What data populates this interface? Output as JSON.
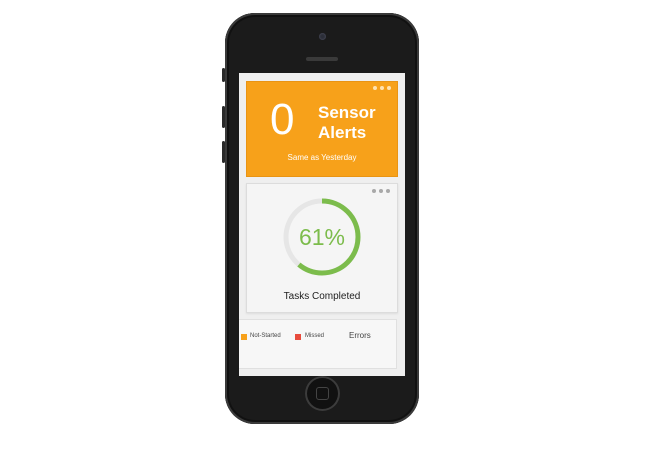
{
  "sensor_card": {
    "count": "0",
    "title_line1": "Sensor",
    "title_line2": "Alerts",
    "subtitle": "Same as Yesterday",
    "bg_color": "#f7a11a",
    "menu_icon": "more-dots-icon"
  },
  "tasks_card": {
    "percent_label": "61%",
    "progress": 0.61,
    "label": "Tasks Completed",
    "ring_color": "#7cbc4c",
    "track_color": "#e6e6e6",
    "menu_icon": "more-dots-icon"
  },
  "legend_card": {
    "items": [
      {
        "label": "Not-Started",
        "color": "#f7a11a"
      },
      {
        "label": "Missed",
        "color": "#e84c3d"
      }
    ],
    "errors_label": "Errors"
  }
}
